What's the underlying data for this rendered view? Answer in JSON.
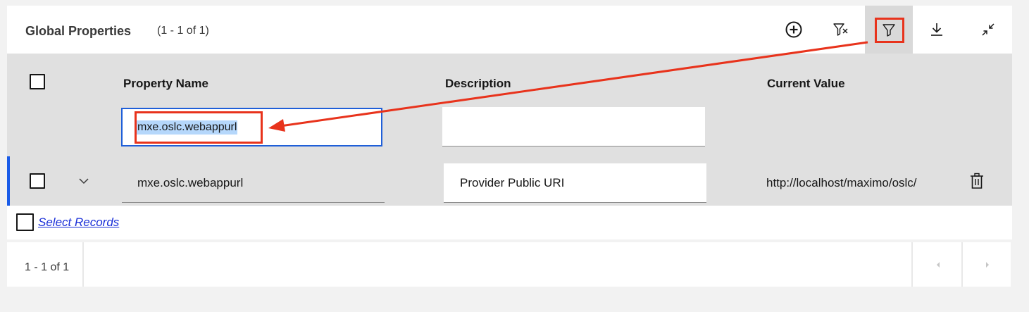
{
  "header": {
    "title": "Global Properties",
    "count": "(1 - 1 of 1)"
  },
  "toolbar": {
    "buttons": [
      {
        "icon": "add-circle-icon"
      },
      {
        "icon": "clear-filter-icon"
      },
      {
        "icon": "filter-icon",
        "active": true
      },
      {
        "icon": "download-icon"
      },
      {
        "icon": "minimize-icon"
      }
    ]
  },
  "table": {
    "columns": [
      "Property Name",
      "Description",
      "Current Value"
    ],
    "filters": {
      "property_name": "mxe.oslc.webappurl",
      "description": ""
    },
    "rows": [
      {
        "property_name": "mxe.oslc.webappurl",
        "description": "Provider Public URI",
        "current_value": "http://localhost/maximo/oslc/"
      }
    ],
    "select_records_label": "Select Records"
  },
  "pagination": {
    "count": "1 - 1 of 1"
  },
  "colors": {
    "annotation": "#e8331c",
    "accent": "#1a5ce8",
    "header_bg": "#e0e0e0",
    "link": "#1a2fd8"
  }
}
